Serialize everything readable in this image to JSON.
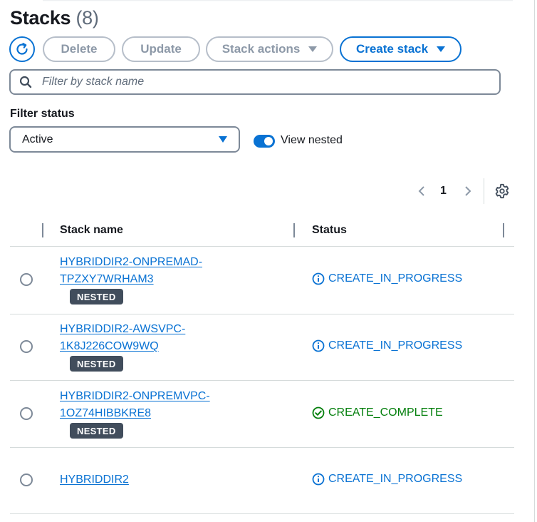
{
  "header": {
    "title": "Stacks",
    "count": "(8)"
  },
  "toolbar": {
    "delete_label": "Delete",
    "update_label": "Update",
    "stack_actions_label": "Stack actions",
    "create_stack_label": "Create stack"
  },
  "search": {
    "placeholder": "Filter by stack name",
    "value": ""
  },
  "filter": {
    "label": "Filter status",
    "selected": "Active",
    "view_nested_label": "View nested",
    "view_nested_on": true
  },
  "pagination": {
    "current_page": "1"
  },
  "table": {
    "columns": [
      "Stack name",
      "Status"
    ],
    "rows": [
      {
        "name_line1": "HYBRIDDIR2-ONPREMAD-",
        "name_line2": "TPZXY7WRHAM3",
        "badge": "NESTED",
        "status": "CREATE_IN_PROGRESS",
        "status_kind": "info"
      },
      {
        "name_line1": "HYBRIDDIR2-AWSVPC-",
        "name_line2": "1K8J226COW9WQ",
        "badge": "NESTED",
        "status": "CREATE_IN_PROGRESS",
        "status_kind": "info"
      },
      {
        "name_line1": "HYBRIDDIR2-ONPREMVPC-",
        "name_line2": "1OZ74HIBBKRE8",
        "badge": "NESTED",
        "status": "CREATE_COMPLETE",
        "status_kind": "success"
      },
      {
        "name_line1": "HYBRIDDIR2",
        "name_line2": "",
        "badge": "",
        "status": "CREATE_IN_PROGRESS",
        "status_kind": "info"
      }
    ]
  },
  "icons": {
    "refresh": "refresh-icon",
    "search": "search-icon",
    "settings": "gear-icon",
    "info": "info-circle-icon",
    "success": "check-circle-icon"
  },
  "colors": {
    "accent": "#0972d3",
    "success": "#037f0c",
    "disabled": "#8d99a8",
    "badge_bg": "#414d5c"
  }
}
